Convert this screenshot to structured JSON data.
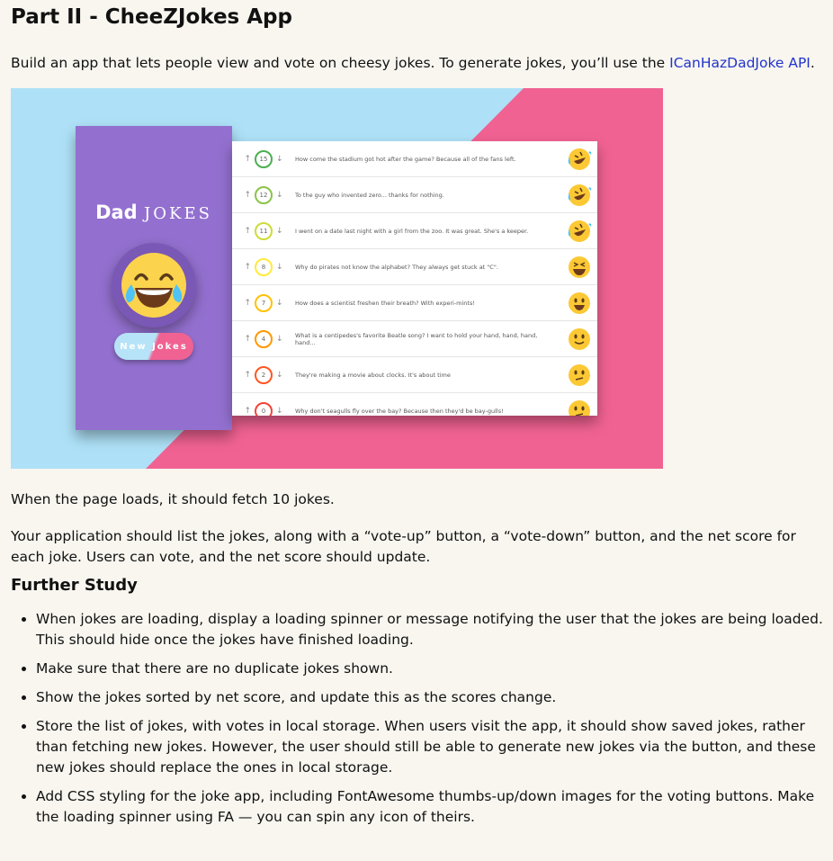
{
  "title": "Part II - CheeZJokes App",
  "intro": {
    "text_before": "Build an app that lets people view and vote on cheesy jokes. To generate jokes, you’ll use the ",
    "link": "ICanHazDadJoke API",
    "text_after": "."
  },
  "illustration": {
    "brand_bold": "Dad",
    "brand_thin": "JOKES",
    "button_label": "New Jokes",
    "jokes": [
      {
        "score": "15",
        "ring": "#4caf50",
        "text": "How come the stadium got hot after the game? Because all of the fans left.",
        "emoji": "rofl"
      },
      {
        "score": "12",
        "ring": "#8bc34a",
        "text": "To the guy who invented zero... thanks for nothing.",
        "emoji": "rofl"
      },
      {
        "score": "11",
        "ring": "#cddc39",
        "text": "I went on a date last night with a girl from the zoo. It was great. She's a keeper.",
        "emoji": "rofl"
      },
      {
        "score": "8",
        "ring": "#ffeb3b",
        "text": "Why do pirates not know the alphabet? They always get stuck at \"C\".",
        "emoji": "laugh"
      },
      {
        "score": "7",
        "ring": "#ffc107",
        "text": "How does a scientist freshen their breath? With experi-mints!",
        "emoji": "smile"
      },
      {
        "score": "4",
        "ring": "#ff9800",
        "text": "What is a centipedes's favorite Beatle song? I want to hold your hand, hand, hand, hand...",
        "emoji": "slight"
      },
      {
        "score": "2",
        "ring": "#ff5722",
        "text": "They're making a movie about clocks. It's about time",
        "emoji": "confused"
      },
      {
        "score": "0",
        "ring": "#f44336",
        "text": "Why don't seagulls fly over the bay? Because then they'd be bay-gulls!",
        "emoji": "confused"
      }
    ]
  },
  "paragraphs": {
    "load": "When the page loads, it should fetch 10 jokes.",
    "list": "Your application should list the jokes, along with a “vote-up” button, a “vote-down” button, and the net score for each joke. Users can vote, and the net score should update."
  },
  "further_study": {
    "heading": "Further Study",
    "items": [
      "When jokes are loading, display a loading spinner or message notifying the user that the jokes are being loaded. This should hide once the jokes have finished loading.",
      "Make sure that there are no duplicate jokes shown.",
      "Show the jokes sorted by net score, and update this as the scores change.",
      "Store the list of jokes, with votes in local storage. When users visit the app, it should show saved jokes, rather than fetching new jokes. However, the user should still be able to generate new jokes via the button, and these new jokes should replace the ones in local storage.",
      "Add CSS styling for the joke app, including FontAwesome thumbs-up/down images for the voting buttons. Make the loading spinner using FA — you can spin any icon of theirs."
    ]
  }
}
